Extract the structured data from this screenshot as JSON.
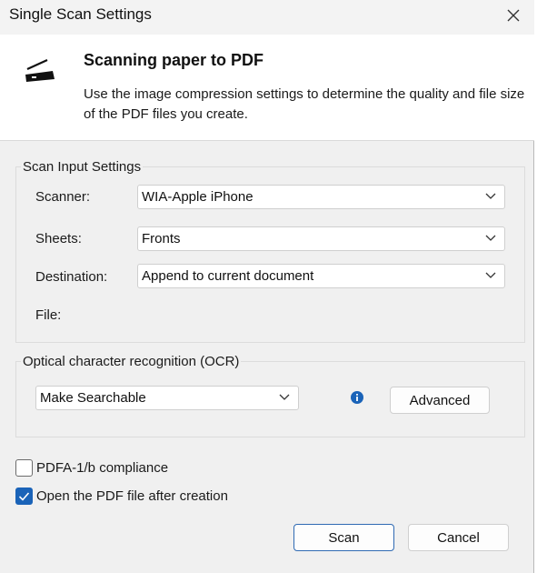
{
  "window": {
    "title": "Single Scan Settings"
  },
  "header": {
    "title": "Scanning paper to PDF",
    "description": "Use the image compression settings to determine the quality and file size of the PDF files you create.",
    "icon": "scanner-icon"
  },
  "scan_input": {
    "legend": "Scan Input Settings",
    "scanner_label": "Scanner:",
    "scanner_value": "WIA-Apple iPhone",
    "sheets_label": "Sheets:",
    "sheets_value": "Fronts",
    "destination_label": "Destination:",
    "destination_value": "Append to current document",
    "file_label": "File:"
  },
  "ocr": {
    "legend": "Optical character recognition (OCR)",
    "mode_value": "Make Searchable",
    "advanced_label": "Advanced",
    "info_icon": "info-icon"
  },
  "options": {
    "pdfa_label": "PDFA-1/b compliance",
    "pdfa_checked": false,
    "open_after_label": "Open the PDF file after creation",
    "open_after_checked": true
  },
  "footer": {
    "scan_label": "Scan",
    "cancel_label": "Cancel"
  },
  "colors": {
    "accent": "#1a63b8",
    "primary_border": "#2f6ab3"
  }
}
